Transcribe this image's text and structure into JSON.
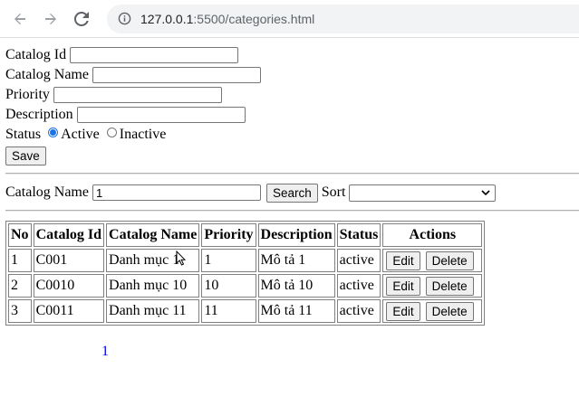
{
  "browser": {
    "url_host": "127.0.0.1",
    "url_path": ":5500/categories.html"
  },
  "form": {
    "catalog_id_label": "Catalog Id",
    "catalog_id_value": "",
    "catalog_name_label": "Catalog Name",
    "catalog_name_value": "",
    "priority_label": "Priority",
    "priority_value": "",
    "description_label": "Description",
    "description_value": "",
    "status_label": "Status",
    "status_options": [
      "Active",
      "Inactive"
    ],
    "status_selected": "Active",
    "save_label": "Save"
  },
  "search": {
    "label": "Catalog Name",
    "value": "1",
    "button_label": "Search",
    "sort_label": "Sort",
    "sort_value": ""
  },
  "table": {
    "headers": [
      "No",
      "Catalog Id",
      "Catalog Name",
      "Priority",
      "Description",
      "Status",
      "Actions"
    ],
    "rows": [
      {
        "no": "1",
        "id": "C001",
        "name": "Danh mục 1",
        "priority": "1",
        "description": "Mô tả 1",
        "status": "active"
      },
      {
        "no": "2",
        "id": "C0010",
        "name": "Danh mục 10",
        "priority": "10",
        "description": "Mô tả 10",
        "status": "active"
      },
      {
        "no": "3",
        "id": "C0011",
        "name": "Danh mục 11",
        "priority": "11",
        "description": "Mô tả 11",
        "status": "active"
      }
    ],
    "edit_label": "Edit",
    "delete_label": "Delete"
  },
  "pagination": {
    "pages": [
      "1"
    ]
  },
  "icons": {
    "back": "arrow-left-icon",
    "forward": "arrow-right-icon",
    "reload": "reload-icon",
    "info": "info-icon",
    "dropdown": "chevron-down-icon"
  }
}
